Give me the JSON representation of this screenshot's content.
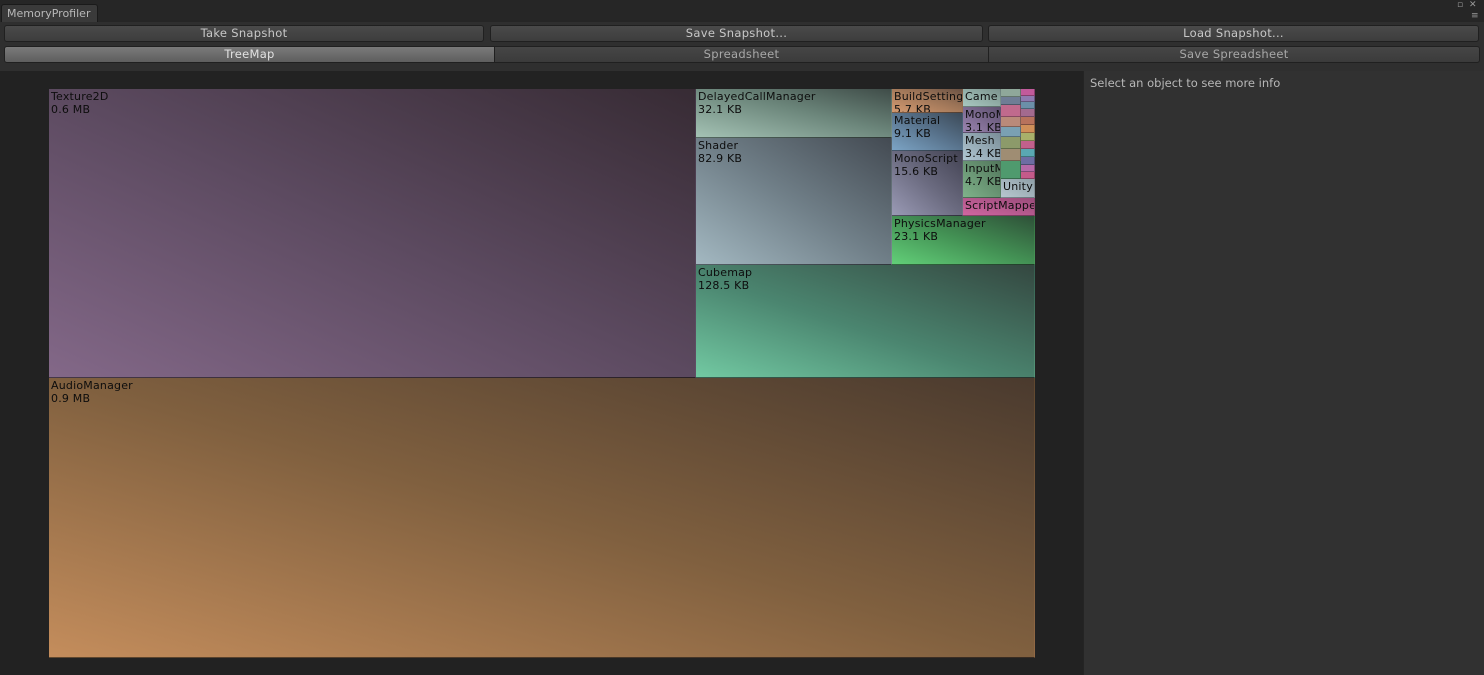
{
  "window": {
    "tab_title": "MemoryProfiler"
  },
  "toolbar": {
    "take_snapshot": "Take Snapshot",
    "save_snapshot": "Save Snapshot...",
    "load_snapshot": "Load Snapshot..."
  },
  "view_tabs": {
    "treemap": "TreeMap",
    "spreadsheet": "Spreadsheet",
    "save_spreadsheet": "Save Spreadsheet"
  },
  "side_panel": {
    "info": "Select an object to see more info"
  },
  "treemap": {
    "texture2d": {
      "name": "Texture2D",
      "size": "0.6 MB"
    },
    "audiomanager": {
      "name": "AudioManager",
      "size": "0.9 MB"
    },
    "delayedcallmanager": {
      "name": "DelayedCallManager",
      "size": "32.1 KB"
    },
    "shader": {
      "name": "Shader",
      "size": "82.9 KB"
    },
    "cubemap": {
      "name": "Cubemap",
      "size": "128.5 KB"
    },
    "buildsettings": {
      "name": "BuildSetting",
      "size": "5.7 KB"
    },
    "material": {
      "name": "Material",
      "size": "9.1 KB"
    },
    "monoscript": {
      "name": "MonoScript",
      "size": "15.6 KB"
    },
    "physicsmanager": {
      "name": "PhysicsManager",
      "size": "23.1 KB"
    },
    "camera": {
      "name": "Came",
      "size": ""
    },
    "monobehaviour": {
      "name": "MonoM",
      "size": "3.1 KB"
    },
    "mesh": {
      "name": "Mesh",
      "size": "3.4 KB"
    },
    "inputmanager": {
      "name": "InputM",
      "size": "4.7 KB"
    },
    "unity": {
      "name": "Unity",
      "size": ""
    },
    "scriptmapper": {
      "name": "ScriptMappe",
      "size": ""
    }
  },
  "colors": {
    "texture2d": "#7f6386",
    "audiomanager": "#c48b59",
    "cubemap": "#6fc7a0",
    "shader": "#9cb2bc",
    "physicsmanager": "#5ec873",
    "scriptmapper": "#c0609a"
  }
}
